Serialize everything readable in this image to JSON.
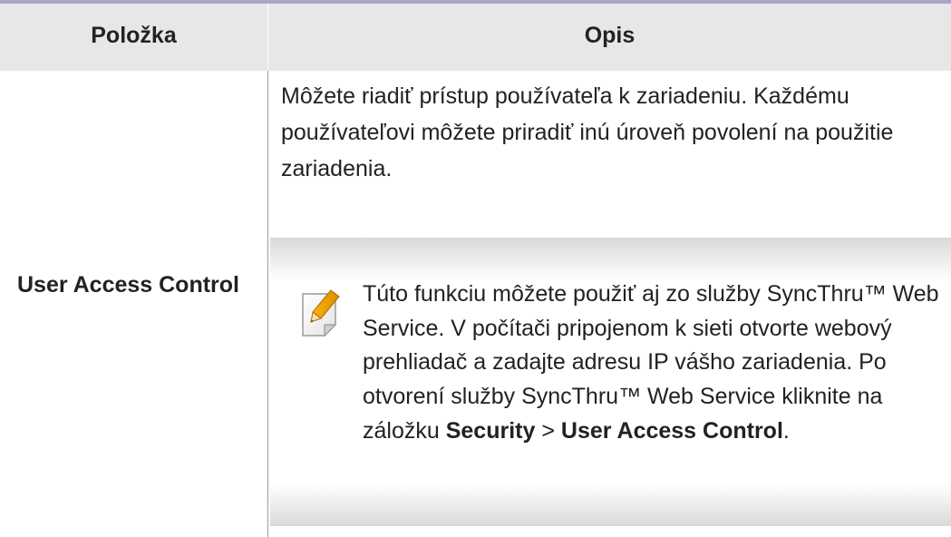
{
  "table": {
    "header": {
      "item": "Položka",
      "description": "Opis"
    },
    "row": {
      "label": "User Access Control",
      "description": "Môžete riadiť prístup používateľa k zariadeniu. Každému používateľovi môžete priradiť inú úroveň povolení na použitie zariadenia.",
      "note": {
        "icon": "note-pencil-icon",
        "text_before": "Túto funkciu môžete použiť aj zo služby SyncThru™ Web Service. V počítači pripojenom k sieti otvorte webový prehliadač a zadajte adresu IP vášho zariadenia. Po otvorení služby SyncThru™ Web Service kliknite na záložku",
        "menu_security": "Security",
        "separator": ">",
        "menu_user_access": "User Access Control",
        "period": "."
      }
    }
  }
}
